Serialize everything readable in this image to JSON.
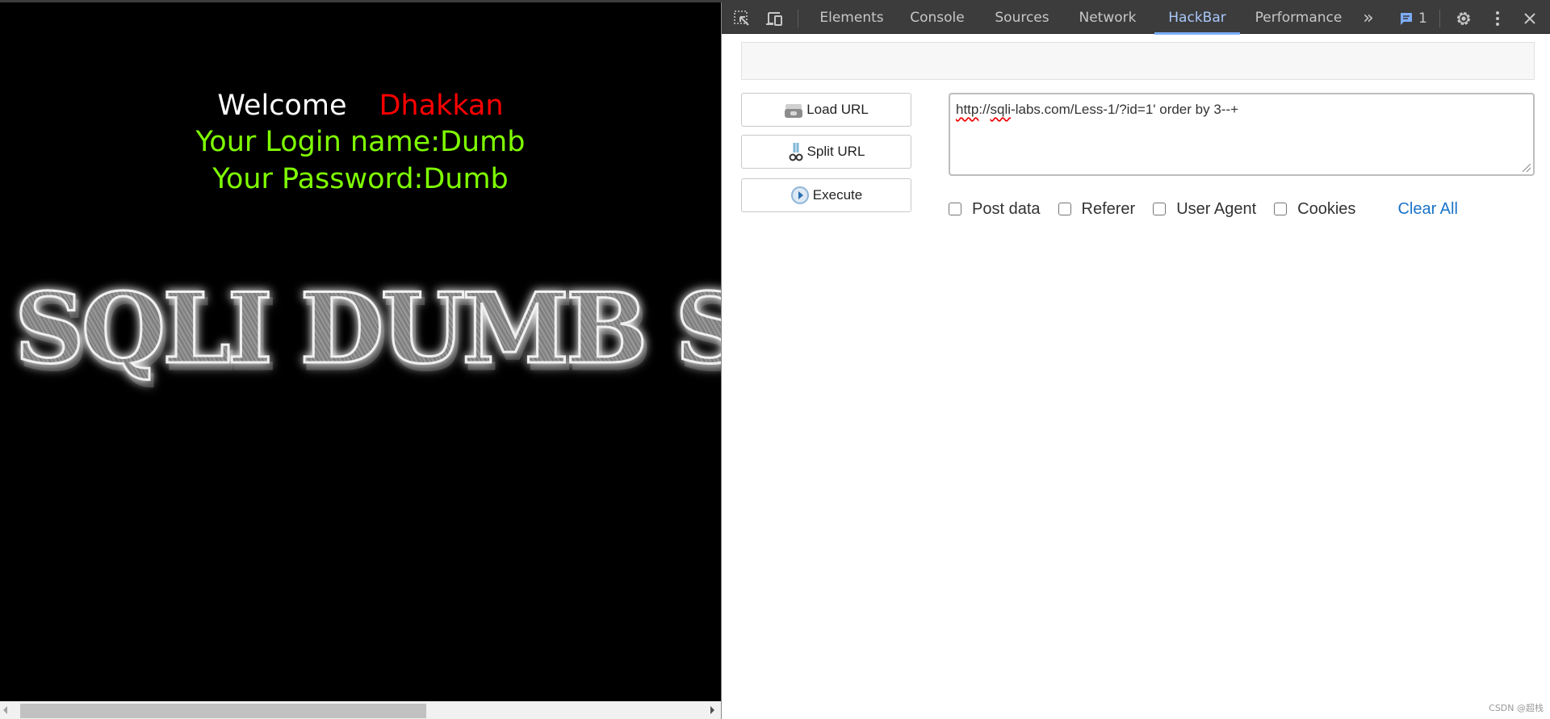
{
  "page": {
    "welcome_label": "Welcome",
    "welcome_name": "Dhakkan",
    "login_line": "Your Login name:Dumb",
    "password_line": "Your Password:Dumb",
    "banner_text": "SQLI DUMB SERIES"
  },
  "devtools": {
    "tabs": [
      {
        "label": "Elements",
        "active": false
      },
      {
        "label": "Console",
        "active": false
      },
      {
        "label": "Sources",
        "active": false
      },
      {
        "label": "Network",
        "active": false
      },
      {
        "label": "HackBar",
        "active": true
      },
      {
        "label": "Performance",
        "active": false
      }
    ],
    "more_tabs": "»",
    "issues_count": "1"
  },
  "hackbar": {
    "load_url": "Load URL",
    "split_url": "Split URL",
    "execute": "Execute",
    "url_value_parts": [
      "http",
      "://",
      "sqli",
      "-labs.com/Less-1/?id=1' order by 3--+"
    ],
    "options": [
      {
        "label": "Post data",
        "checked": false
      },
      {
        "label": "Referer",
        "checked": false
      },
      {
        "label": "User Agent",
        "checked": false
      },
      {
        "label": "Cookies",
        "checked": false
      }
    ],
    "clear_all": "Clear All"
  },
  "watermark": "CSDN @超栈",
  "colors": {
    "accent": "#a8c7fa",
    "link": "#1a73c8",
    "green": "#7fff00",
    "red": "#ff0000"
  }
}
